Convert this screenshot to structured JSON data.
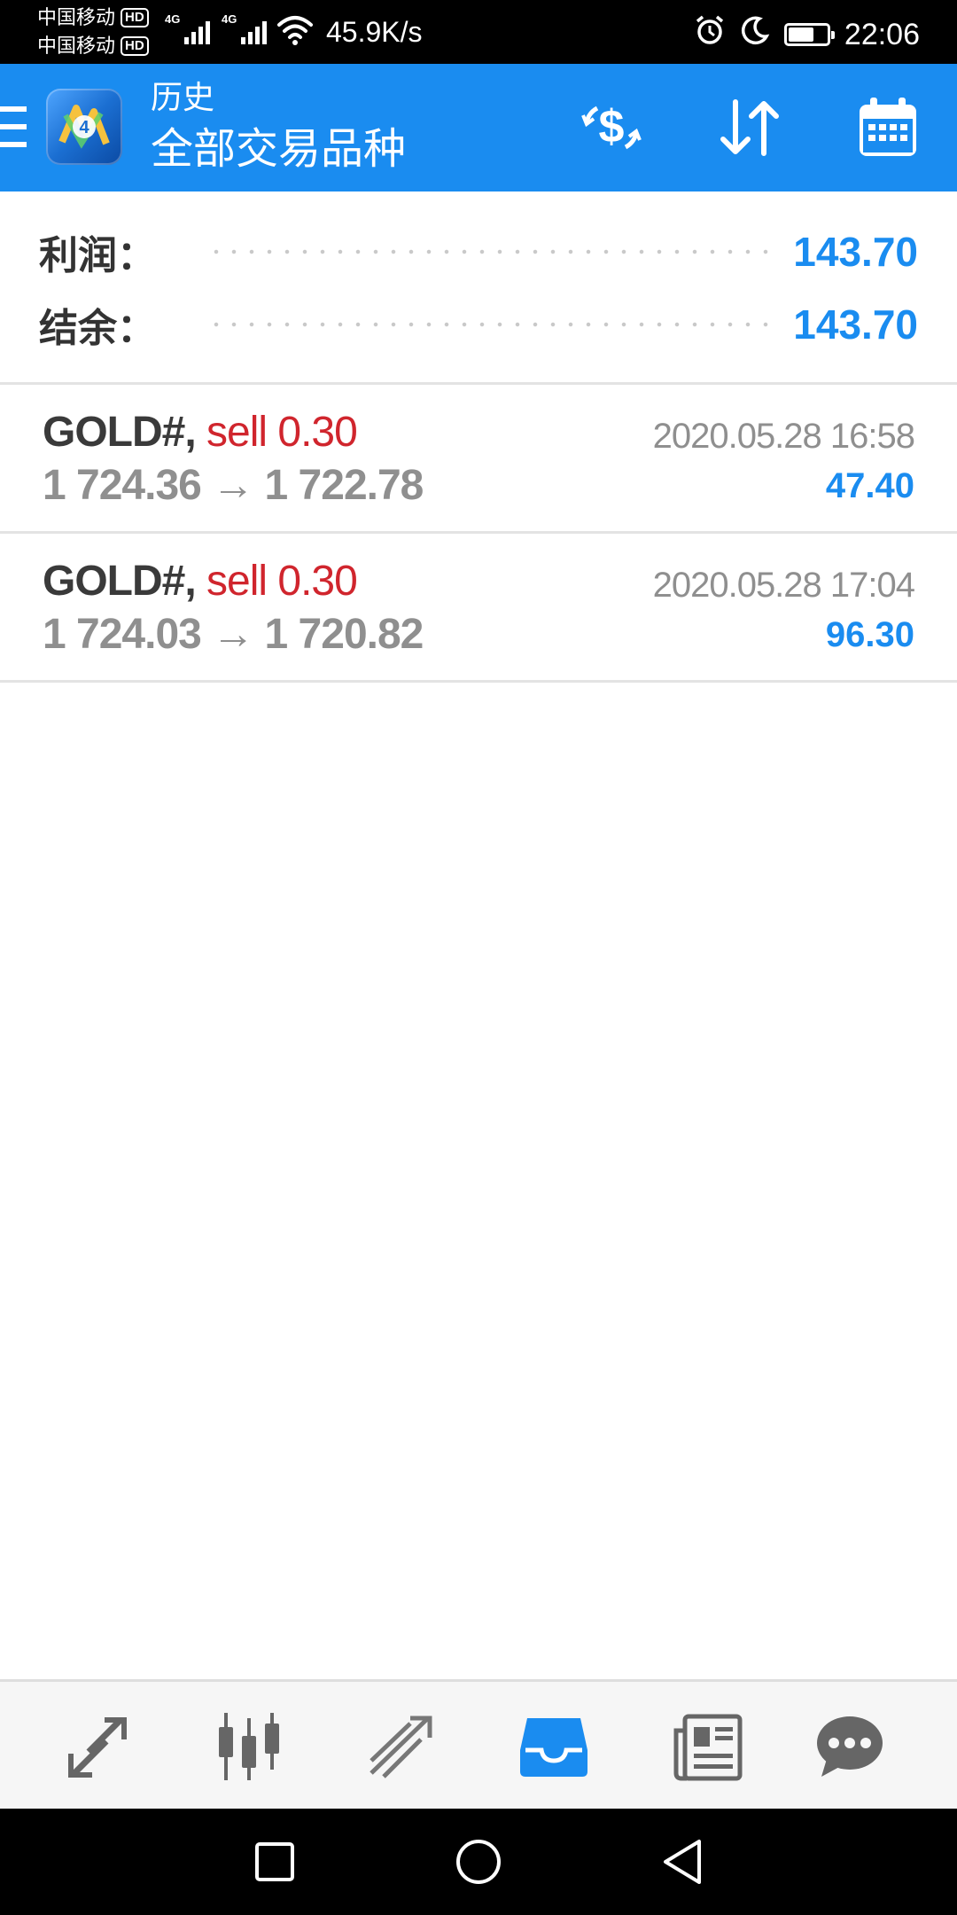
{
  "status_bar": {
    "carrier1": "中国移动",
    "carrier2": "中国移动",
    "hd_badge": "HD",
    "network1": "4G",
    "network2": "4G",
    "speed": "45.9K/s",
    "time": "22:06",
    "battery_level": 0.6
  },
  "app_bar": {
    "title_small": "历史",
    "title_large": "全部交易品种",
    "icons": [
      "menu-icon",
      "metatrader-logo",
      "currency-exchange-icon",
      "sort-icon",
      "calendar-icon"
    ]
  },
  "summary": {
    "profit_label": "利润：",
    "profit_value": "143.70",
    "balance_label": "结余：",
    "balance_value": "143.70"
  },
  "deals": [
    {
      "symbol": "GOLD#,",
      "type": "sell 0.30",
      "prices": "1 724.36 → 1 722.78",
      "time": "2020.05.28 16:58",
      "profit": "47.40"
    },
    {
      "symbol": "GOLD#,",
      "type": "sell 0.30",
      "prices": "1 724.03 → 1 720.82",
      "time": "2020.05.28 17:04",
      "profit": "96.30"
    }
  ],
  "bottom_nav": {
    "tabs": [
      "quotes-icon",
      "chart-icon",
      "trade-icon",
      "history-icon",
      "news-icon",
      "chat-icon"
    ],
    "active": "history-icon"
  },
  "colors": {
    "accent": "#1a8cf0",
    "sell": "#d0252d",
    "muted": "#8f8f8f"
  }
}
